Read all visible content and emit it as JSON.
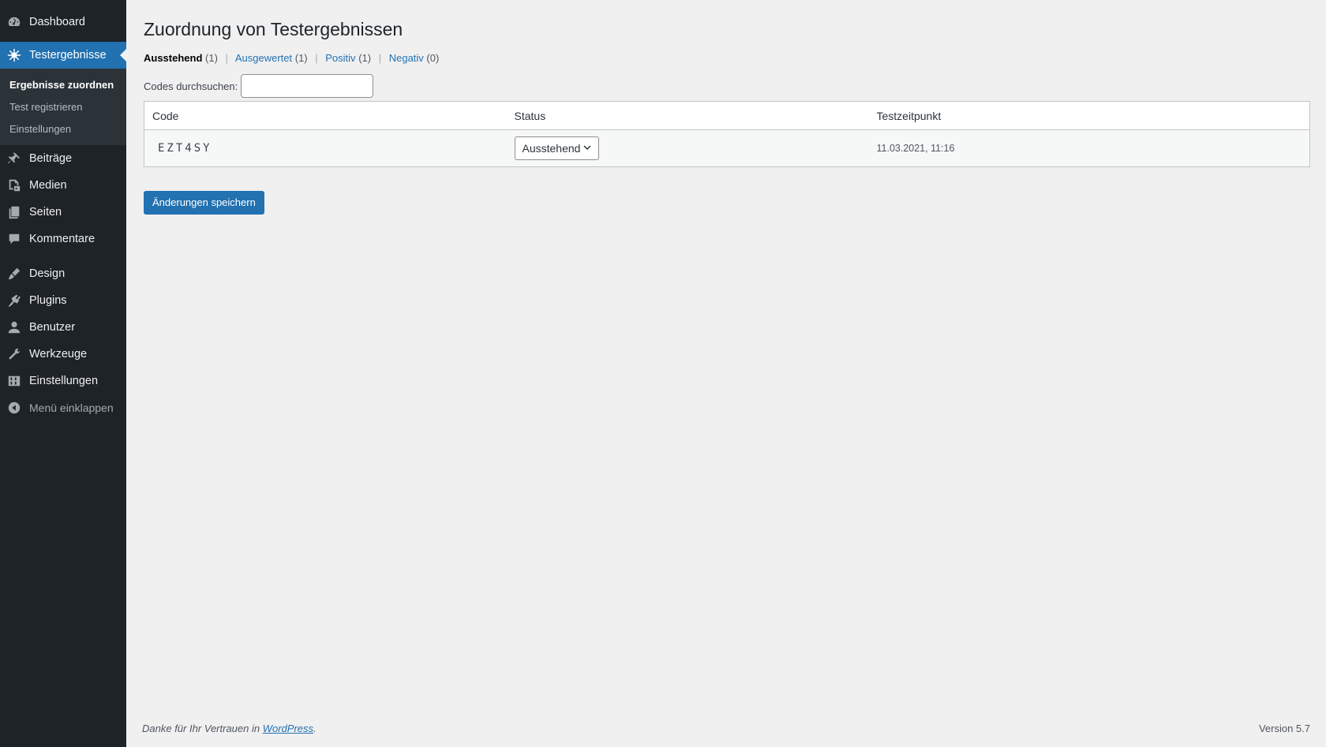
{
  "sidebar": {
    "items_top": [
      {
        "label": "Dashboard",
        "icon": "dashboard-icon"
      }
    ],
    "active": {
      "label": "Testergebnisse",
      "icon": "virus-icon"
    },
    "submenu": [
      {
        "label": "Ergebnisse zuordnen",
        "current": true
      },
      {
        "label": "Test registrieren",
        "current": false
      },
      {
        "label": "Einstellungen",
        "current": false
      }
    ],
    "items_group1": [
      {
        "label": "Beiträge",
        "icon": "pin-icon"
      },
      {
        "label": "Medien",
        "icon": "media-icon"
      },
      {
        "label": "Seiten",
        "icon": "pages-icon"
      },
      {
        "label": "Kommentare",
        "icon": "comment-icon"
      }
    ],
    "items_group2": [
      {
        "label": "Design",
        "icon": "brush-icon"
      },
      {
        "label": "Plugins",
        "icon": "plugin-icon"
      },
      {
        "label": "Benutzer",
        "icon": "user-icon"
      },
      {
        "label": "Werkzeuge",
        "icon": "wrench-icon"
      },
      {
        "label": "Einstellungen",
        "icon": "settings-icon"
      }
    ],
    "collapse_label": "Menü einklappen"
  },
  "page": {
    "title": "Zuordnung von Testergebnissen",
    "filters": [
      {
        "label": "Ausstehend",
        "count": "(1)",
        "current": true
      },
      {
        "label": "Ausgewertet",
        "count": "(1)",
        "current": false
      },
      {
        "label": "Positiv",
        "count": "(1)",
        "current": false
      },
      {
        "label": "Negativ",
        "count": "(0)",
        "current": false
      }
    ],
    "search_label": "Codes durchsuchen:",
    "search_value": "",
    "table": {
      "headers": [
        "Code",
        "Status",
        "Testzeitpunkt"
      ],
      "rows": [
        {
          "code": "EZT4SY",
          "status": "Ausstehend",
          "time": "11.03.2021, 11:16"
        }
      ]
    },
    "save_label": "Änderungen speichern"
  },
  "footer": {
    "thanks_prefix": "Danke für Ihr Vertrauen in ",
    "thanks_link": "WordPress",
    "thanks_suffix": ".",
    "version": "Version 5.7"
  },
  "colors": {
    "sidebar_bg": "#1d2327",
    "accent": "#2271b1",
    "page_bg": "#f0f0f1"
  }
}
